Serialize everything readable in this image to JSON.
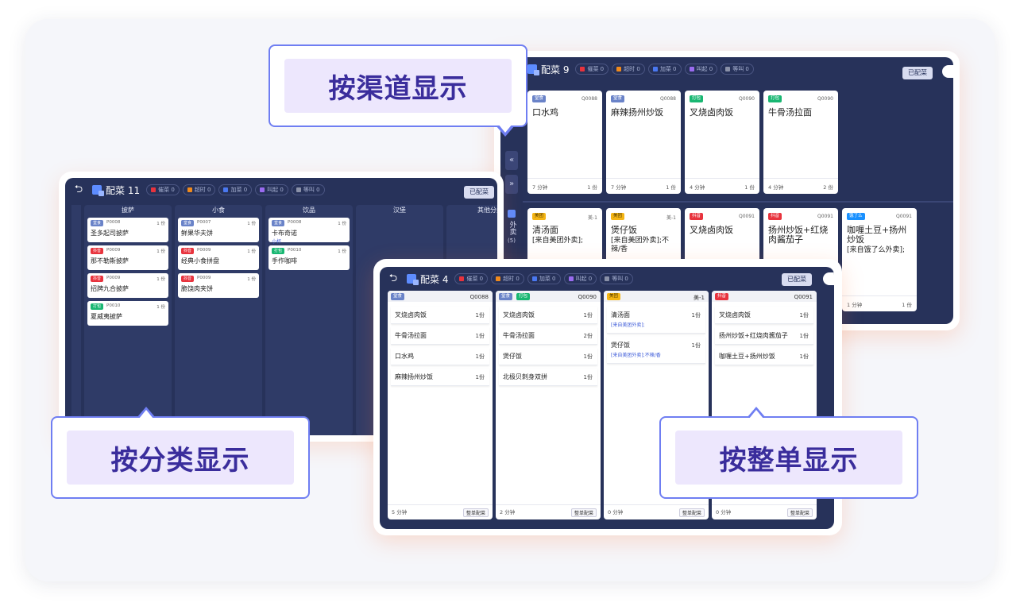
{
  "views": {
    "channel": {
      "callout": "按渠道显示",
      "title": "配菜 9",
      "pills": [
        {
          "label": "催菜 0",
          "color": "#e8333d"
        },
        {
          "label": "超时 0",
          "color": "#f08a1c"
        },
        {
          "label": "加菜 0",
          "color": "#4a78f0"
        },
        {
          "label": "叫起 0",
          "color": "#9a6bf0"
        },
        {
          "label": "等叫 0",
          "color": "#8a91a8"
        }
      ],
      "done_label": "已配菜",
      "side_arrows": [
        "«",
        "»"
      ],
      "side_channel": {
        "label": "外卖",
        "count": "(5)"
      },
      "top_cards": [
        {
          "tag": "堂食",
          "tag_class": "t-tang",
          "no": "Q0088",
          "name": "口水鸡",
          "time": "7 分钟",
          "qty": "1 份"
        },
        {
          "tag": "堂食",
          "tag_class": "t-tang",
          "no": "Q0088",
          "name": "麻辣扬州炒饭",
          "time": "7 分钟",
          "qty": "1 份"
        },
        {
          "tag": "打包",
          "tag_class": "t-da",
          "no": "Q0090",
          "name": "叉烧卤肉饭",
          "time": "4 分钟",
          "qty": "1 份"
        },
        {
          "tag": "打包",
          "tag_class": "t-da",
          "no": "Q0090",
          "name": "牛骨汤拉面",
          "time": "4 分钟",
          "qty": "2 份"
        }
      ],
      "bottom_cards": [
        {
          "tag": "美团",
          "tag_class": "t-mt",
          "no": "美-1",
          "name": "清汤面",
          "note": "[来自美团外卖];"
        },
        {
          "tag": "美团",
          "tag_class": "t-mt",
          "no": "美-1",
          "name": "煲仔饭",
          "note": "[来自美团外卖];不辣/香"
        },
        {
          "tag": "抖音",
          "tag_class": "t-dy",
          "no": "Q0091",
          "name": "叉烧卤肉饭",
          "note": ""
        },
        {
          "tag": "抖音",
          "tag_class": "t-dy",
          "no": "Q0091",
          "name": "扬州炒饭+红烧肉酱茄子",
          "note": ""
        },
        {
          "tag": "饿了么",
          "tag_class": "t-el",
          "no": "Q0091",
          "name": "咖喱土豆+扬州炒饭",
          "note": "[来自饿了么外卖];",
          "time": "1 分钟",
          "qty": "1 份"
        }
      ]
    },
    "category": {
      "callout": "按分类显示",
      "title": "配菜 11",
      "pills": [
        {
          "label": "催菜 0",
          "color": "#e8333d"
        },
        {
          "label": "超时 0",
          "color": "#f08a1c"
        },
        {
          "label": "加菜 0",
          "color": "#4a78f0"
        },
        {
          "label": "叫起 0",
          "color": "#9a6bf0"
        },
        {
          "label": "等叫 0",
          "color": "#8a91a8"
        }
      ],
      "done_label": "已配菜",
      "columns": [
        {
          "name": "披萨",
          "items": [
            {
              "tag": "堂食",
              "tag_class": "t-tang",
              "no": "P0008",
              "name": "圣多起司披萨",
              "qty": "1 份",
              "note": ""
            },
            {
              "tag": "抖音",
              "tag_class": "t-dy",
              "no": "P0009",
              "name": "那不勒斯披萨",
              "qty": "1 份",
              "note": ""
            },
            {
              "tag": "抖音",
              "tag_class": "t-dy",
              "no": "P0009",
              "name": "招牌九合披萨",
              "qty": "1 份",
              "note": ""
            },
            {
              "tag": "打包",
              "tag_class": "t-da",
              "no": "P0010",
              "name": "夏威夷披萨",
              "qty": "1 份",
              "note": ""
            }
          ]
        },
        {
          "name": "小食",
          "items": [
            {
              "tag": "堂食",
              "tag_class": "t-tang",
              "no": "P0007",
              "name": "鲜果华夫饼",
              "qty": "1 份",
              "note": ""
            },
            {
              "tag": "抖音",
              "tag_class": "t-dy",
              "no": "P0009",
              "name": "经典小食拼盘",
              "qty": "1 份",
              "note": ""
            },
            {
              "tag": "抖音",
              "tag_class": "t-dy",
              "no": "P0009",
              "name": "脆饶肉夹饼",
              "qty": "1 份",
              "note": ""
            }
          ]
        },
        {
          "name": "饮品",
          "items": [
            {
              "tag": "堂食",
              "tag_class": "t-tang",
              "no": "P0008",
              "name": "卡布奇诺",
              "qty": "1 份",
              "note": "小杯"
            },
            {
              "tag": "打包",
              "tag_class": "t-da",
              "no": "P0010",
              "name": "手作咖啡",
              "qty": "1 份",
              "note": ""
            }
          ]
        },
        {
          "name": "汉堡",
          "items": []
        },
        {
          "name": "其他分类",
          "items": []
        }
      ]
    },
    "order": {
      "callout": "按整单显示",
      "title": "配菜 4",
      "pills": [
        {
          "label": "催菜 0",
          "color": "#e8333d"
        },
        {
          "label": "超时 0",
          "color": "#f08a1c"
        },
        {
          "label": "加菜 0",
          "color": "#4a78f0"
        },
        {
          "label": "叫起 0",
          "color": "#9a6bf0"
        },
        {
          "label": "等叫 0",
          "color": "#8a91a8"
        }
      ],
      "done_label": "已配菜",
      "orders": [
        {
          "tags": [
            {
              "t": "堂食",
              "c": "t-tang"
            }
          ],
          "no": "Q0088",
          "time": "5 分钟",
          "action": "整单配菜",
          "lines": [
            {
              "name": "叉烧卤肉饭",
              "qty": "1份",
              "note": ""
            },
            {
              "name": "牛骨汤拉面",
              "qty": "1份",
              "note": ""
            },
            {
              "name": "口水鸡",
              "qty": "1份",
              "note": ""
            },
            {
              "name": "麻辣扬州炒饭",
              "qty": "1份",
              "note": ""
            }
          ]
        },
        {
          "tags": [
            {
              "t": "堂食",
              "c": "t-tang"
            },
            {
              "t": "打包",
              "c": "t-da"
            }
          ],
          "no": "Q0090",
          "time": "2 分钟",
          "action": "整单配菜",
          "lines": [
            {
              "name": "叉烧卤肉饭",
              "qty": "1份",
              "note": ""
            },
            {
              "name": "牛骨汤拉面",
              "qty": "2份",
              "note": ""
            },
            {
              "name": "煲仔饭",
              "qty": "1份",
              "note": ""
            },
            {
              "name": "北极贝刺身双拼",
              "qty": "1份",
              "note": ""
            }
          ]
        },
        {
          "tags": [
            {
              "t": "美团",
              "c": "t-mt"
            }
          ],
          "no": "美-1",
          "time": "0 分钟",
          "action": "整单配菜",
          "lines": [
            {
              "name": "清汤面",
              "qty": "1份",
              "note": "[来自美团外卖];"
            },
            {
              "name": "煲仔饭",
              "qty": "1份",
              "note": "[来自美团外卖];不辣/香"
            }
          ]
        },
        {
          "tags": [
            {
              "t": "抖音",
              "c": "t-dy"
            }
          ],
          "no": "Q0091",
          "time": "0 分钟",
          "action": "整单配菜",
          "lines": [
            {
              "name": "叉烧卤肉饭",
              "qty": "1份",
              "note": ""
            },
            {
              "name": "扬州炒饭+红烧肉酱茄子",
              "qty": "1份",
              "note": ""
            },
            {
              "name": "咖喱土豆+扬州炒饭",
              "qty": "1份",
              "note": ""
            }
          ]
        }
      ]
    }
  }
}
